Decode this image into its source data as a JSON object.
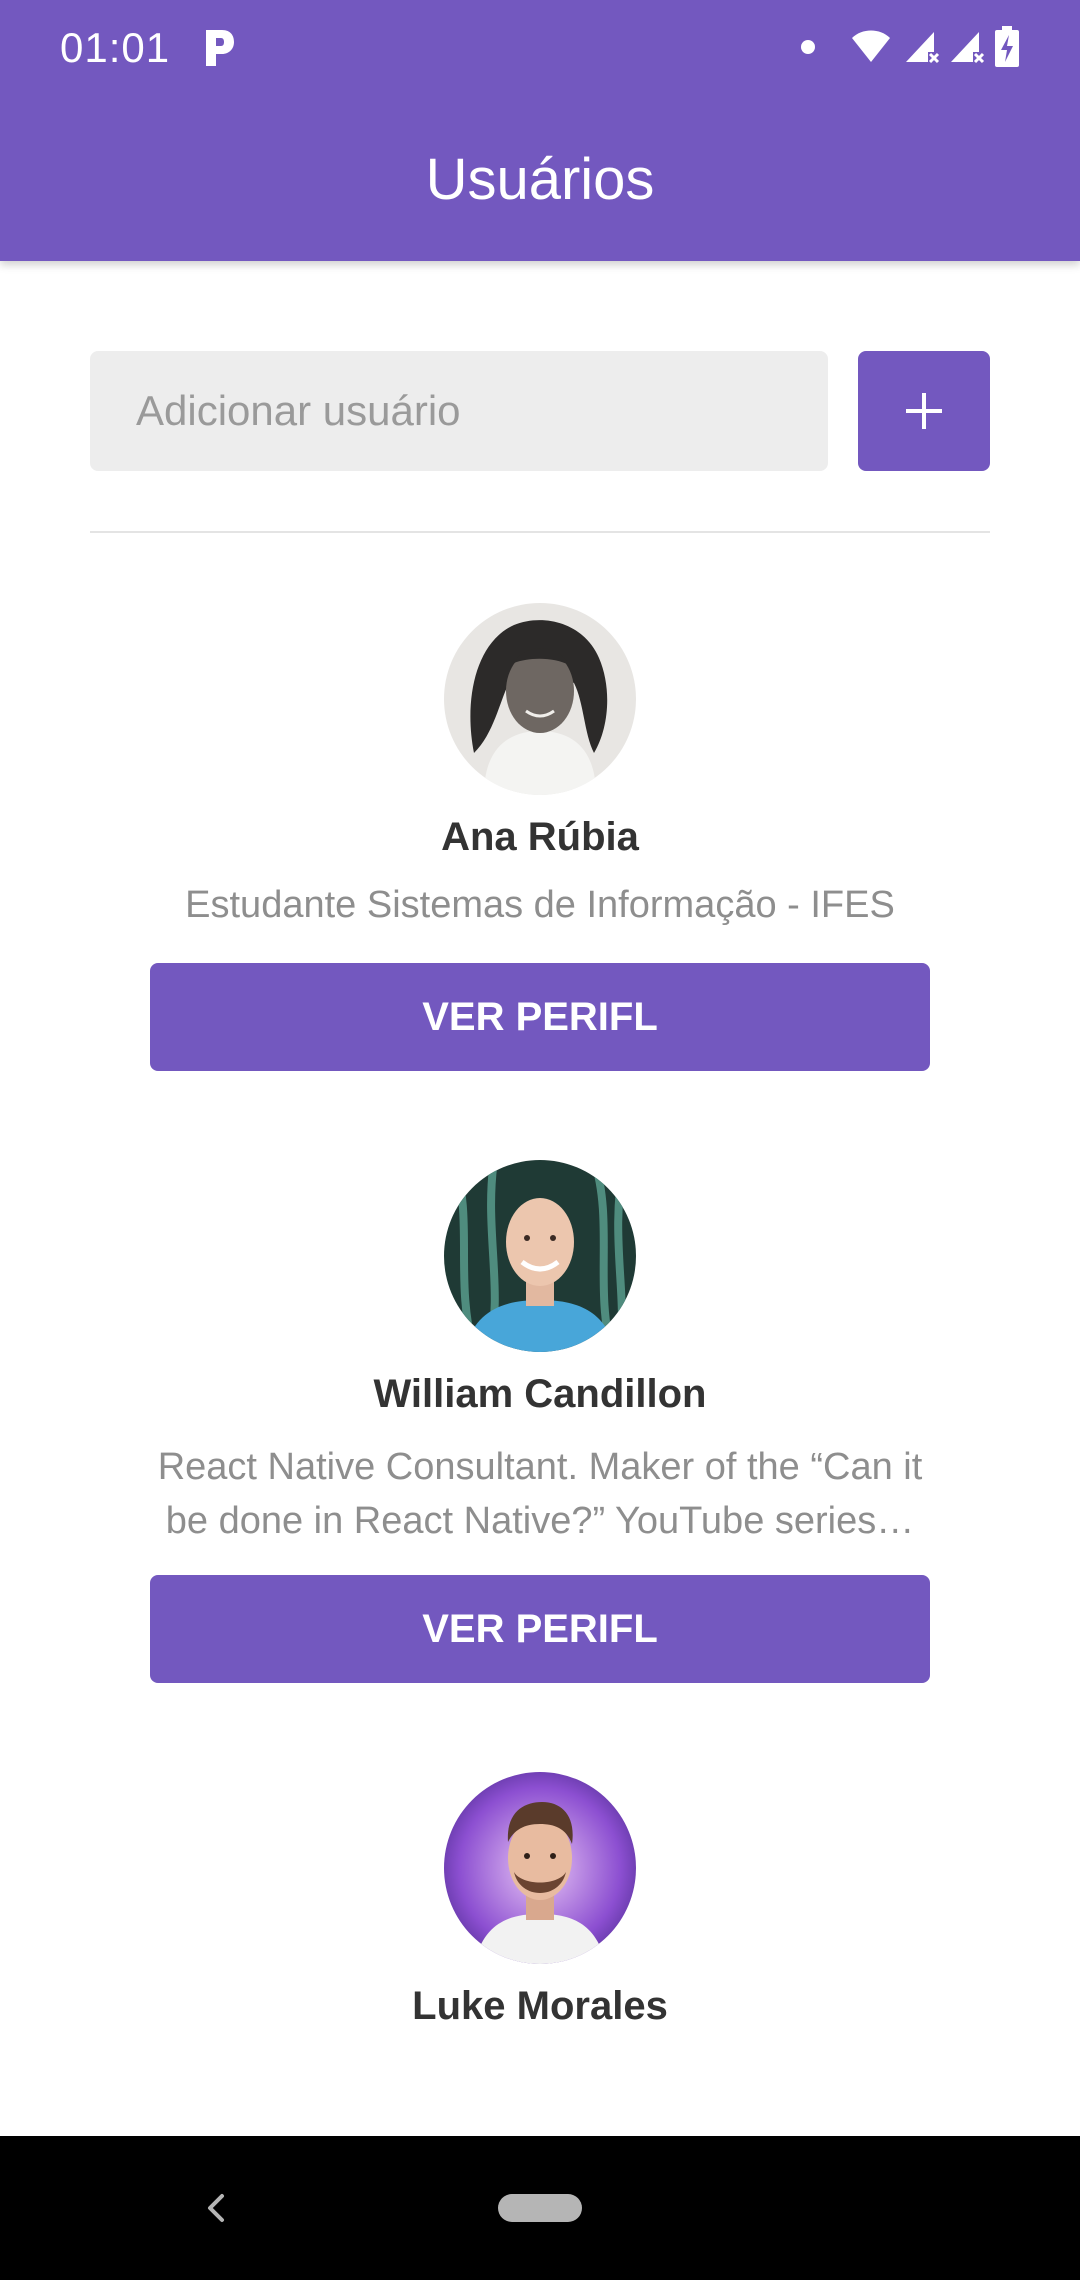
{
  "status_bar": {
    "time": "01:01",
    "icons": [
      "parking-app-icon",
      "notification-dot-icon",
      "wifi-icon",
      "signal-no-service-icon",
      "signal-no-service-icon",
      "battery-charging-icon"
    ]
  },
  "header": {
    "title": "Usuários"
  },
  "add_user": {
    "placeholder": "Adicionar usuário",
    "value": "",
    "button_icon": "plus-icon"
  },
  "users": [
    {
      "name": "Ana Rúbia",
      "bio": "Estudante Sistemas de Informação - IFES",
      "button_label": "VER PERIFL"
    },
    {
      "name": "William Candillon",
      "bio": "React Native Consultant. Maker of the “Can it be done in React Native?” YouTube series…",
      "button_label": "VER PERIFL"
    },
    {
      "name": "Luke Morales",
      "bio": "",
      "button_label": ""
    }
  ],
  "nav_bar": {
    "icons": [
      "back-icon",
      "home-pill-icon"
    ]
  },
  "colors": {
    "primary": "#7358bf",
    "input_background": "#ededed",
    "name_text": "#333333",
    "bio_text": "#8e8e8e"
  }
}
